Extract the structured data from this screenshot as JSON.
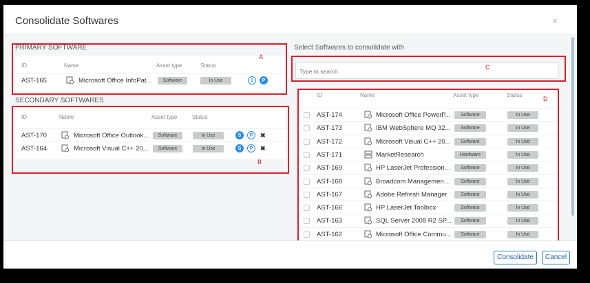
{
  "dialog": {
    "title": "Consolidate Softwares",
    "close_glyph": "×",
    "consolidate_label": "Consolidate",
    "cancel_label": "Cancel"
  },
  "annotations": {
    "a": "A",
    "b": "B",
    "c": "C",
    "d": "D",
    "color": "#d9202e"
  },
  "primary": {
    "heading": "PRIMARY SOFTWARE",
    "columns": {
      "id": "ID",
      "name": "Name",
      "asset_type": "Asset type",
      "status": "Status"
    },
    "row": {
      "id": "AST-165",
      "name": "Microsoft Office InfoPat...",
      "asset_type": "Software",
      "status": "In Use",
      "s": "S",
      "p": "P"
    }
  },
  "secondary": {
    "heading": "SECONDARY SOFTWARES",
    "columns": {
      "id": "ID",
      "name": "Name",
      "asset_type": "Asset type",
      "status": "Status"
    },
    "rows": [
      {
        "id": "AST-170",
        "name": "Microsoft Office Outlook...",
        "asset_type": "Software",
        "status": "In Use",
        "s": "S",
        "p": "P",
        "remove": "✖"
      },
      {
        "id": "AST-164",
        "name": "Microsoft Visual C++ 20...",
        "asset_type": "Software",
        "status": "In Use",
        "s": "S",
        "p": "P",
        "remove": "✖"
      }
    ]
  },
  "select": {
    "heading": "Select Softwares to consolidate with",
    "search_placeholder": "Type to search",
    "columns": {
      "id": "ID",
      "name": "Name",
      "asset_type": "Asset type",
      "status": "Status"
    },
    "rows": [
      {
        "id": "AST-174",
        "name": "Microsoft Office PowerP...",
        "asset_type": "Software",
        "status": "In Use",
        "icon": "software-icon"
      },
      {
        "id": "AST-173",
        "name": "IBM WebSphere MQ 32...",
        "asset_type": "Software",
        "status": "In Use",
        "icon": "software-icon"
      },
      {
        "id": "AST-172",
        "name": "Microsoft Visual C++ 20...",
        "asset_type": "Software",
        "status": "In Use",
        "icon": "software-icon"
      },
      {
        "id": "AST-171",
        "name": "MarketResearch",
        "asset_type": "Hardware",
        "status": "In Use",
        "icon": "hardware-icon"
      },
      {
        "id": "AST-169",
        "name": "HP LaserJet Professiona...",
        "asset_type": "Software",
        "status": "In Use",
        "icon": "software-icon"
      },
      {
        "id": "AST-168",
        "name": "Broadcom Management ...",
        "asset_type": "Software",
        "status": "In Use",
        "icon": "software-icon"
      },
      {
        "id": "AST-167",
        "name": "Adobe Refresh Manager",
        "asset_type": "Software",
        "status": "In Use",
        "icon": "software-icon"
      },
      {
        "id": "AST-166",
        "name": "HP LaserJet Toolbox",
        "asset_type": "Software",
        "status": "In Use",
        "icon": "software-icon"
      },
      {
        "id": "AST-163",
        "name": "SQL Server 2008 R2 SP...",
        "asset_type": "Software",
        "status": "In Use",
        "icon": "software-icon"
      },
      {
        "id": "AST-162",
        "name": "Microsoft Office Commu...",
        "asset_type": "Software",
        "status": "In Use",
        "icon": "software-icon"
      }
    ]
  }
}
